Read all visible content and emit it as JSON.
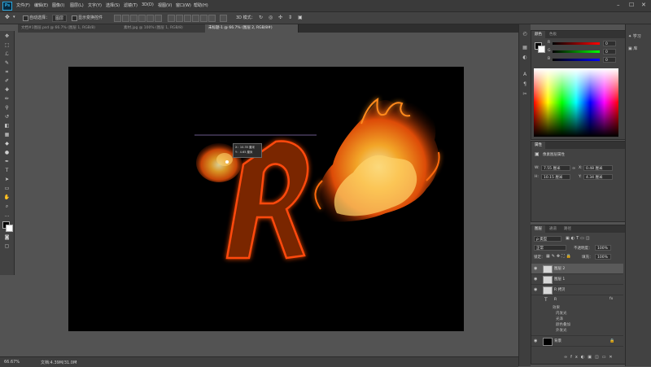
{
  "app": {
    "logo": "Ps"
  },
  "menu": [
    "文件(F)",
    "编辑(E)",
    "图像(I)",
    "图层(L)",
    "文字(Y)",
    "选择(S)",
    "滤镜(T)",
    "3D(D)",
    "视图(V)",
    "窗口(W)",
    "帮助(H)"
  ],
  "options_bar": {
    "auto_select_label": "自动选择：",
    "auto_select_target": "图层",
    "show_transform_label": "显示变换控件",
    "mode_label": "3D 模式："
  },
  "tabs": [
    {
      "label": "文档#1图层.psd @ 66.7% (图层 1, RGB/8)",
      "active": false
    },
    {
      "label": "素材.jpg @ 100% (图层 1, RGB/8)",
      "active": false
    },
    {
      "label": "未标题-1 @ 66.7% (图层 2, RGB/8#)",
      "active": true
    }
  ],
  "status": {
    "zoom": "66.67%",
    "doc": "文档:4.39M/31.0M"
  },
  "tooltip": {
    "line1": "X：10.35 厘米",
    "line2": "Y：4.65 厘米"
  },
  "color_panel": {
    "tabs": [
      "颜色",
      "色板"
    ],
    "r": "0",
    "g": "0",
    "b": "0",
    "accent_fg": "#000000",
    "accent_bg": "#ffffff"
  },
  "properties_panel": {
    "title": "属性",
    "subtitle": "像素图层属性",
    "w_label": "W:",
    "w_value": "7.55 厘米",
    "h_label": "H:",
    "h_value": "10.15 厘米",
    "x_label": "X:",
    "x_value": "0.48 厘米",
    "y_label": "Y:",
    "y_value": "4.34 厘米"
  },
  "layers_panel": {
    "tabs": [
      "图层",
      "通道",
      "路径"
    ],
    "kind_label": "ρ 类型",
    "blend_mode": "正常",
    "opacity_label": "不透明度：",
    "opacity_value": "100%",
    "lock_label": "锁定：",
    "fill_label": "填充：",
    "fill_value": "100%",
    "layers": [
      {
        "name": "图层 2",
        "selected": true,
        "thumb": "#d8d8d8"
      },
      {
        "name": "图层 1",
        "selected": false,
        "thumb": "#d8d8d8"
      },
      {
        "name": "R 拷贝",
        "selected": false,
        "thumb": "#d8d8d8"
      }
    ],
    "text_layer": {
      "glyph": "T",
      "name": "R",
      "fx": "fx"
    },
    "effects_header": "效果",
    "effects": [
      "内发光",
      "光泽",
      "颜色叠加",
      "外发光"
    ],
    "background": {
      "name": "背景",
      "thumb": "#000000"
    }
  },
  "far_panel": {
    "items": [
      "学习",
      "库"
    ]
  },
  "colors": {
    "ui_dark": "#3a3a3a",
    "canvas": "#000000",
    "glow": "#ff3a00",
    "letter": "#8a2a06"
  }
}
